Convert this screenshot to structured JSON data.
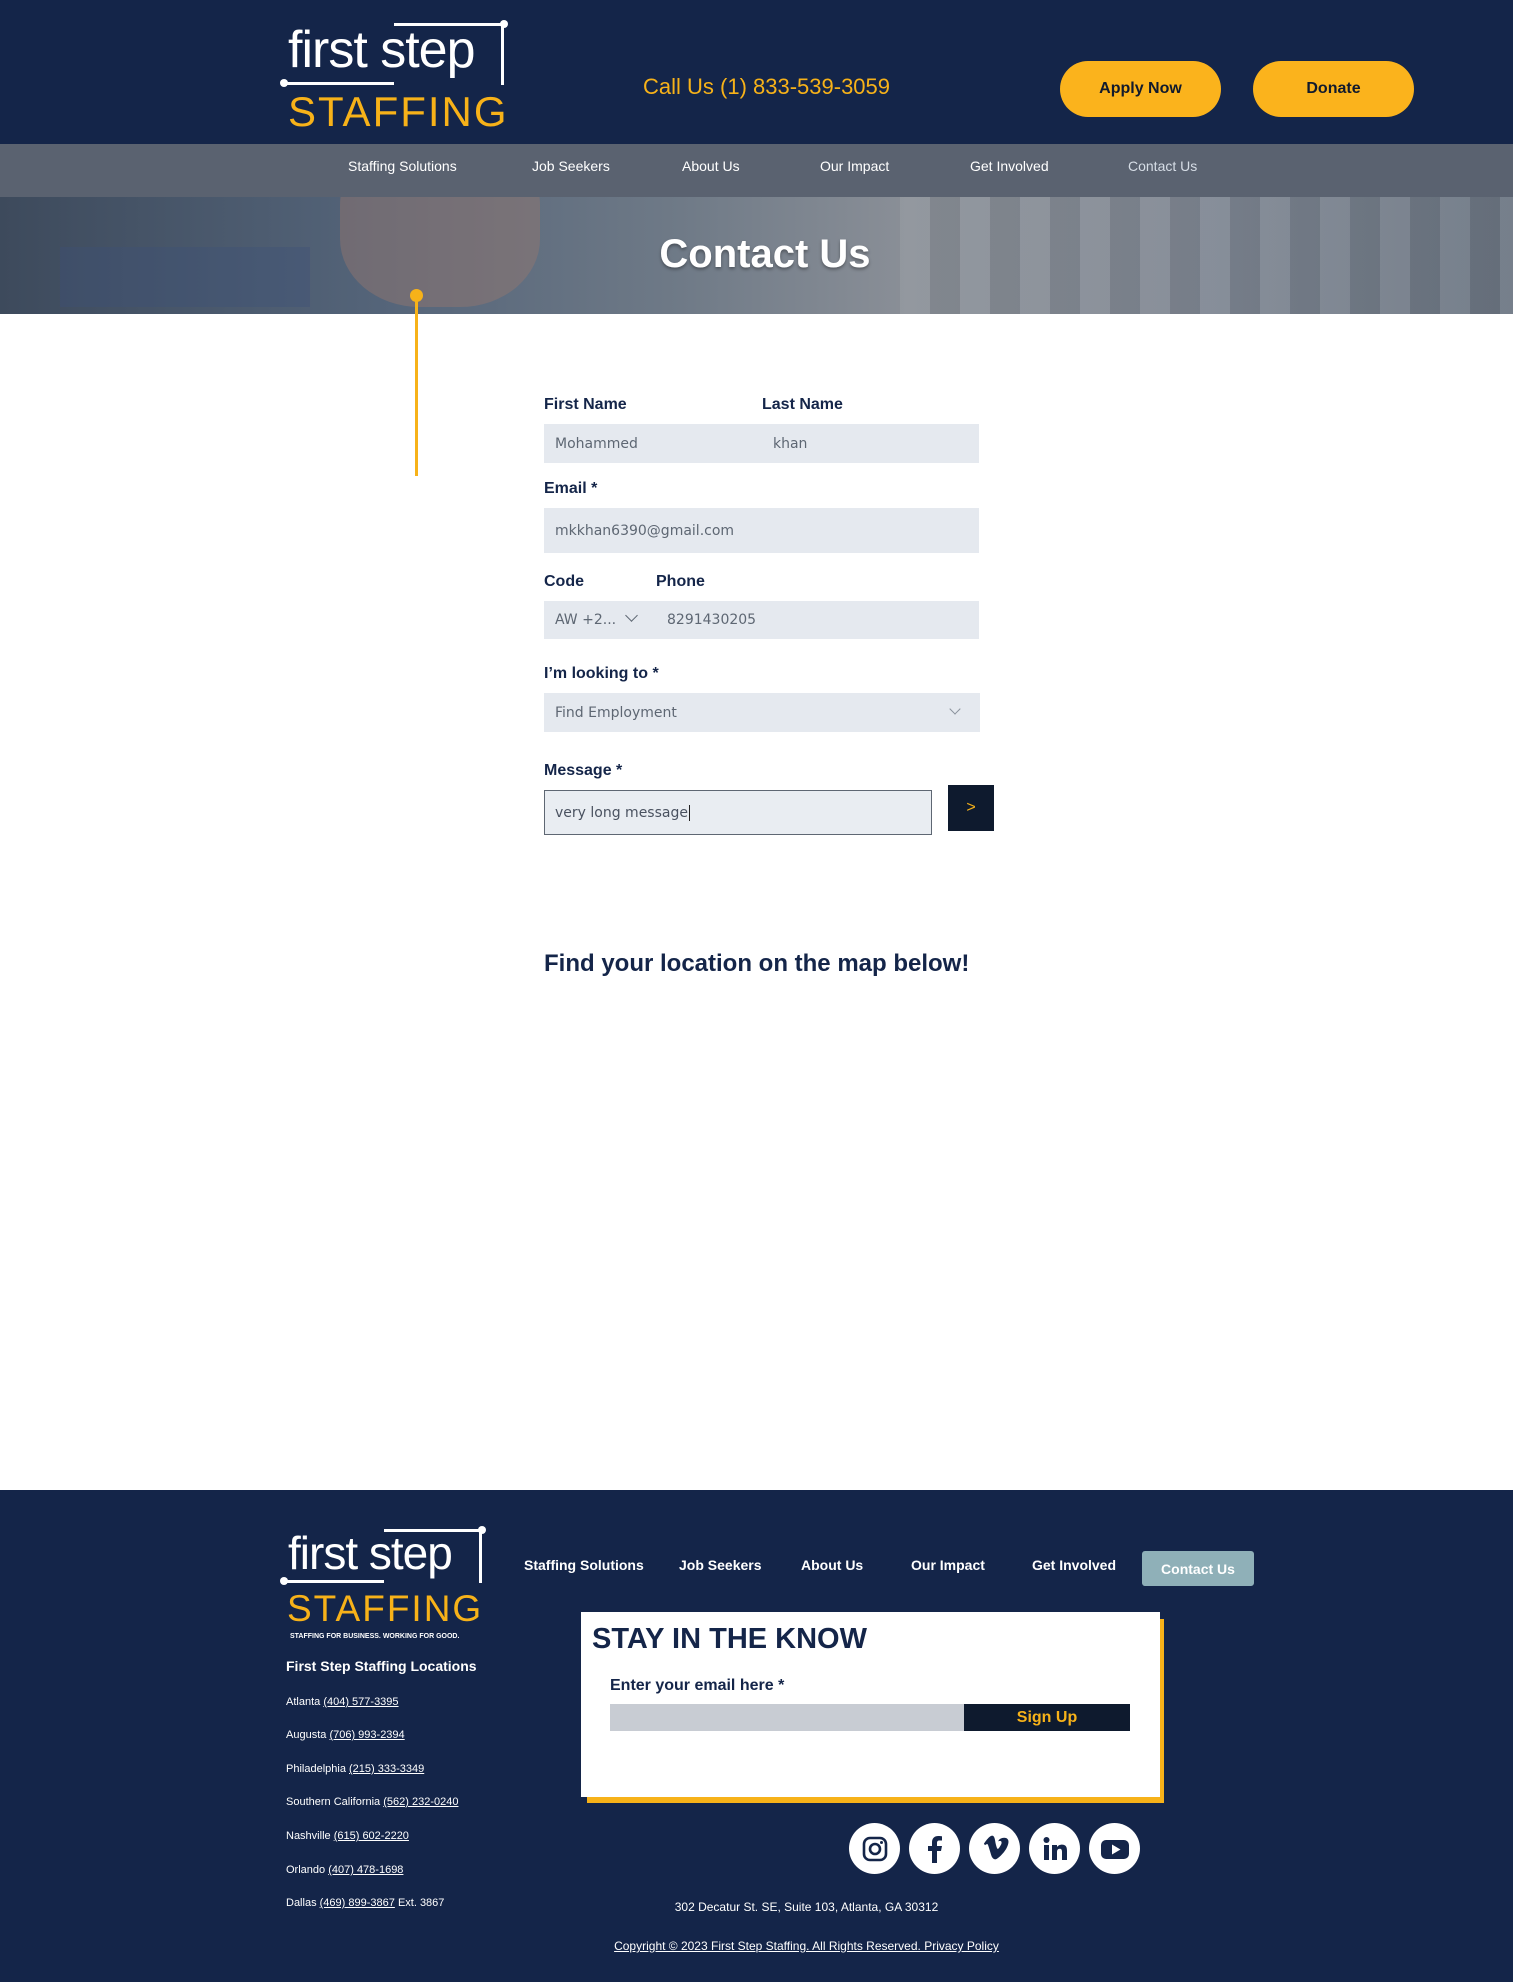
{
  "header": {
    "logo_top": "first step",
    "logo_bottom": "STAFFING",
    "call_text": "Call Us (1) 833-539-3059",
    "apply_label": "Apply Now",
    "donate_label": "Donate"
  },
  "nav": {
    "items": [
      "Staffing Solutions",
      "Job Seekers",
      "About Us",
      "Our Impact",
      "Get Involved",
      "Contact Us"
    ]
  },
  "hero": {
    "title": "Contact Us"
  },
  "form": {
    "first_name_label": "First Name",
    "first_name_value": "Mohammed",
    "last_name_label": "Last Name",
    "last_name_value": "khan",
    "email_label": "Email *",
    "email_value": "mkkhan6390@gmail.com",
    "code_label": "Code",
    "code_value": "AW +2...",
    "phone_label": "Phone",
    "phone_value": "8291430205",
    "looking_label": "I’m looking to *",
    "looking_value": "Find Employment",
    "message_label": "Message *",
    "message_value": "very long message",
    "send_label": ">"
  },
  "map_heading": "Find your location on the map below!",
  "footer": {
    "logo_top": "first step",
    "logo_bottom": "STAFFING",
    "tagline": "STAFFING FOR BUSINESS. WORKING FOR GOOD.",
    "nav": [
      "Staffing Solutions",
      "Job Seekers",
      "About Us",
      "Our Impact",
      "Get Involved",
      "Contact Us"
    ],
    "locations_title": "First Step Staffing Locations",
    "locations": [
      {
        "city": "Atlanta",
        "phone": "(404) 577-3395",
        "ext": ""
      },
      {
        "city": "Augusta",
        "phone": "(706) 993-2394",
        "ext": ""
      },
      {
        "city": "Philadelphia",
        "phone": "(215) 333-3349",
        "ext": ""
      },
      {
        "city": "Southern California",
        "phone": "(562) 232-0240",
        "ext": ""
      },
      {
        "city": "Nashville",
        "phone": "(615) 602-2220",
        "ext": ""
      },
      {
        "city": "Orlando",
        "phone": "(407) 478-1698",
        "ext": ""
      },
      {
        "city": "Dallas",
        "phone": "(469) 899-3867",
        "ext": "Ext. 3867"
      }
    ],
    "newsletter": {
      "title": "STAY IN THE KNOW",
      "email_label": "Enter your email here *",
      "signup_label": "Sign Up"
    },
    "social": [
      "instagram-icon",
      "facebook-icon",
      "vimeo-icon",
      "linkedin-icon",
      "youtube-icon"
    ],
    "address": "302 Decatur St. SE, Suite 103, Atlanta, GA 30312",
    "copyright": "Copyright © 2023  First Step Staffing. All Rights Reserved. Privacy Policy"
  },
  "colors": {
    "navy": "#142549",
    "gold": "#f7b219",
    "field_bg": "#e5e9ef",
    "dark_button": "#0e1a2e",
    "active_nav": "#8fb0b8"
  }
}
